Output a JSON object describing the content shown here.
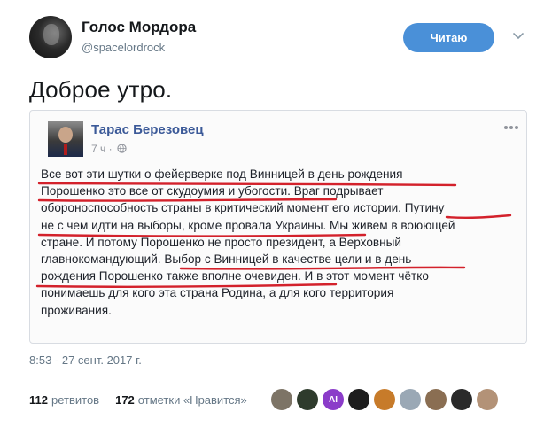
{
  "author": {
    "name": "Голос Мордора",
    "handle": "@spacelordrock"
  },
  "follow_button": {
    "label": "Читаю"
  },
  "tweet": {
    "text": "Доброе утро."
  },
  "embed": {
    "author_name": "Тарас Березовец",
    "time": "7 ч ·",
    "body_lines": [
      "Все вот эти шутки о фейерверке под Винницей в день рождения",
      "Порошенко это все от скудоумия и убогости. Враг подрывает",
      "обороноспособность страны в критический момент его истории. Путину",
      "не с чем идти на выборы, кроме провала Украины. Мы живем в воюющей",
      "стране. И потому Порошенко не просто президент, а Верховный",
      "главнокомандующий. Выбор с Винницей в качестве цели и в день",
      "рождения Порошенко также вполне очевиден. И в этот момент чётко",
      "понимаешь для кого эта страна Родина, а для кого территория",
      "проживания."
    ],
    "underline_color": "#d3212b"
  },
  "footer": {
    "timestamp": "8:53 - 27 сент. 2017 г.",
    "retweets_count": "112",
    "retweets_label": "ретвитов",
    "likes_count": "172",
    "likes_label": "отметки «Нравится»"
  },
  "likers": [
    {
      "initials": "",
      "color": "#7d7466"
    },
    {
      "initials": "",
      "color": "#2e3b2c"
    },
    {
      "initials": "AI",
      "color": "#8b3cc9"
    },
    {
      "initials": "",
      "color": "#1d1d1d"
    },
    {
      "initials": "",
      "color": "#c77b2a"
    },
    {
      "initials": "",
      "color": "#9aa8b5"
    },
    {
      "initials": "",
      "color": "#8a6e52"
    },
    {
      "initials": "",
      "color": "#2a2a2a"
    },
    {
      "initials": "",
      "color": "#b39277"
    }
  ],
  "colors": {
    "accent": "#4a90d8",
    "fb_link": "#3b5998",
    "muted": "#657786"
  }
}
